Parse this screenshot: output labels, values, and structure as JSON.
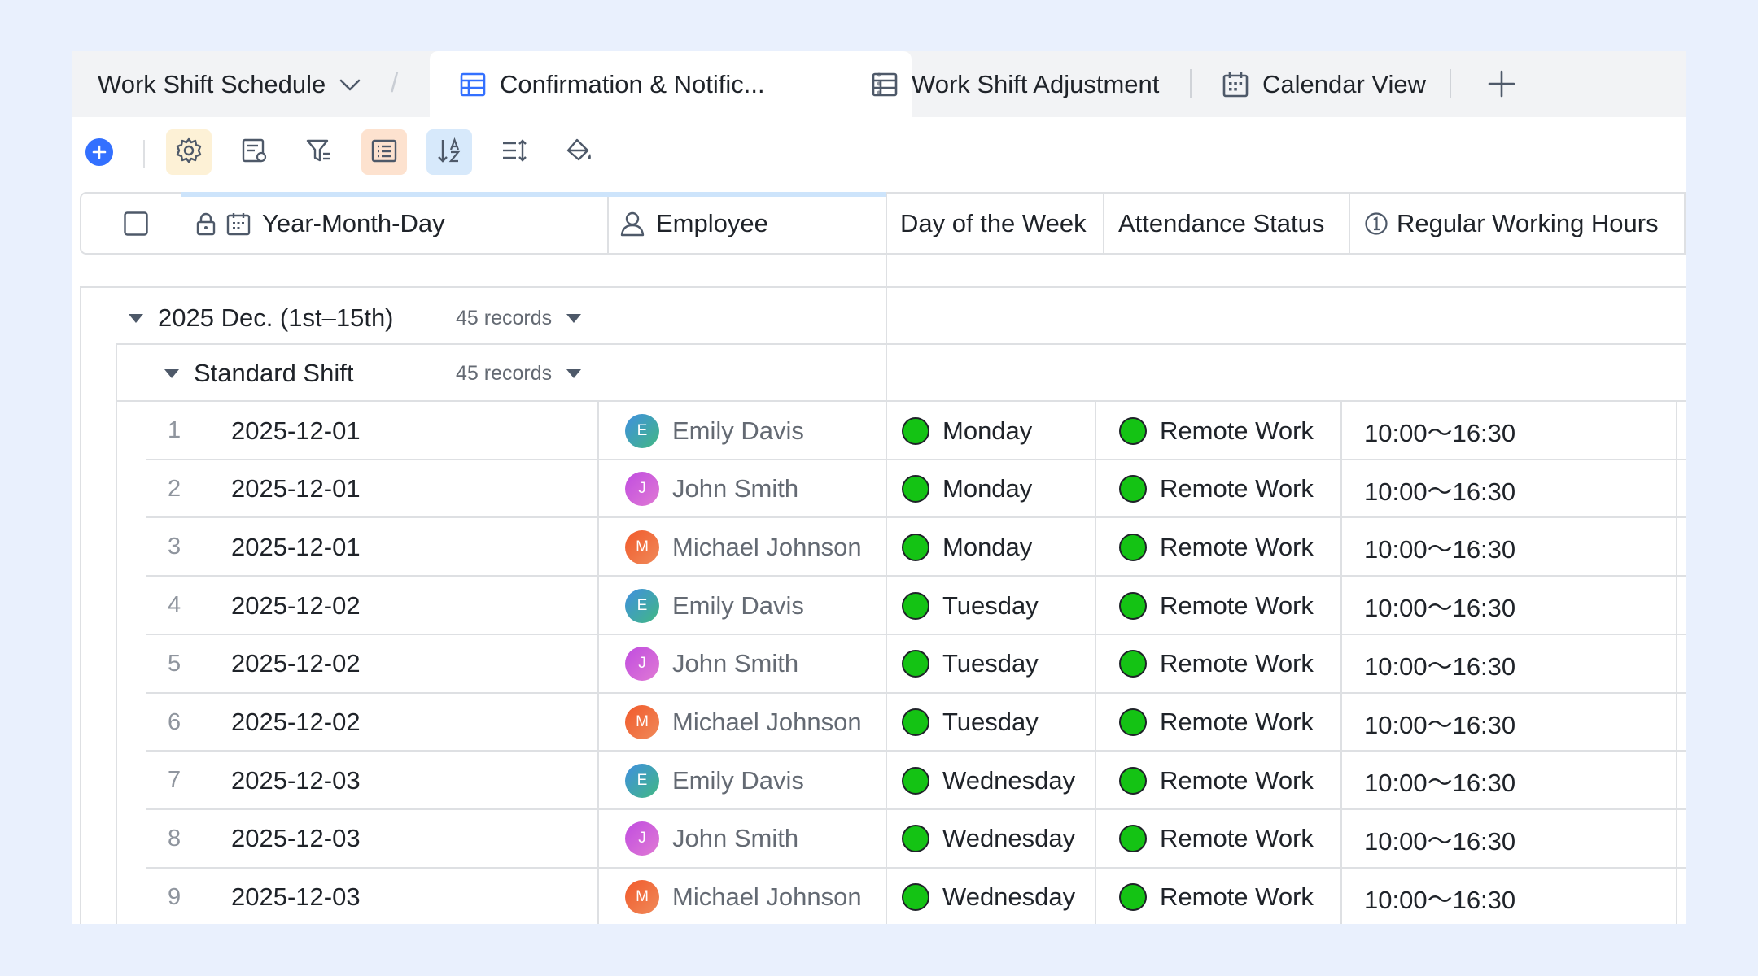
{
  "tabs": {
    "base_name": "Work Shift Schedule",
    "active": "Confirmation & Notific...",
    "adjustment": "Work Shift Adjustment",
    "calendar": "Calendar View"
  },
  "columns": {
    "date": "Year-Month-Day",
    "employee": "Employee",
    "day": "Day of the Week",
    "attendance": "Attendance Status",
    "hours": "Regular Working Hours"
  },
  "groups": {
    "outer": {
      "label": "2025 Dec. (1st–15th)",
      "count": "45 records"
    },
    "inner": {
      "label": "Standard Shift",
      "count": "45 records"
    }
  },
  "colors": {
    "accent": "#3370ff",
    "status_green": "#14c314",
    "avatar_emily": "#3f8fe0",
    "avatar_john": "#c04ce0",
    "avatar_michael": "#f15a2b"
  },
  "rows": [
    {
      "index": "1",
      "date": "2025-12-01",
      "initial": "E",
      "employee": "Emily Davis",
      "day": "Monday",
      "status": "Remote Work",
      "hours": "10:00～16:30"
    },
    {
      "index": "2",
      "date": "2025-12-01",
      "initial": "J",
      "employee": "John Smith",
      "day": "Monday",
      "status": "Remote Work",
      "hours": "10:00～16:30"
    },
    {
      "index": "3",
      "date": "2025-12-01",
      "initial": "M",
      "employee": "Michael Johnson",
      "day": "Monday",
      "status": "Remote Work",
      "hours": "10:00～16:30"
    },
    {
      "index": "4",
      "date": "2025-12-02",
      "initial": "E",
      "employee": "Emily Davis",
      "day": "Tuesday",
      "status": "Remote Work",
      "hours": "10:00～16:30"
    },
    {
      "index": "5",
      "date": "2025-12-02",
      "initial": "J",
      "employee": "John Smith",
      "day": "Tuesday",
      "status": "Remote Work",
      "hours": "10:00～16:30"
    },
    {
      "index": "6",
      "date": "2025-12-02",
      "initial": "M",
      "employee": "Michael Johnson",
      "day": "Tuesday",
      "status": "Remote Work",
      "hours": "10:00～16:30"
    },
    {
      "index": "7",
      "date": "2025-12-03",
      "initial": "E",
      "employee": "Emily Davis",
      "day": "Wednesday",
      "status": "Remote Work",
      "hours": "10:00～16:30"
    },
    {
      "index": "8",
      "date": "2025-12-03",
      "initial": "J",
      "employee": "John Smith",
      "day": "Wednesday",
      "status": "Remote Work",
      "hours": "10:00～16:30"
    },
    {
      "index": "9",
      "date": "2025-12-03",
      "initial": "M",
      "employee": "Michael Johnson",
      "day": "Wednesday",
      "status": "Remote Work",
      "hours": "10:00～16:30"
    }
  ]
}
